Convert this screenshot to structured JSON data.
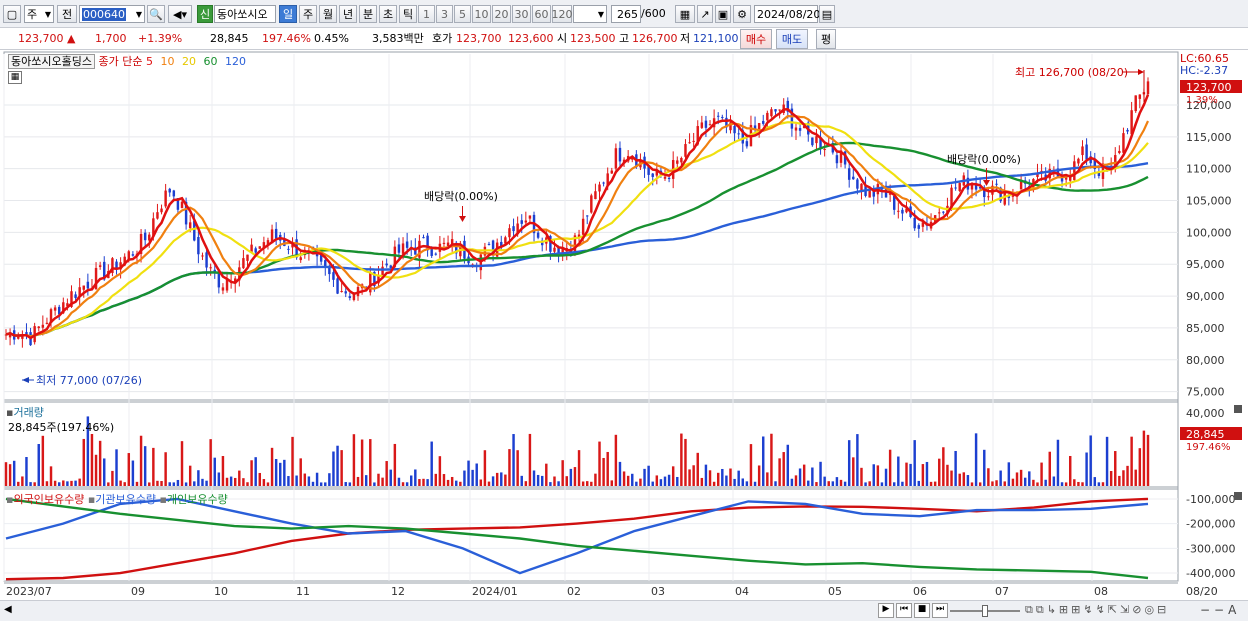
{
  "toolbar": {
    "period_label": "주",
    "prefix_label": "전",
    "stock_code": "000640",
    "credit_badge": "신",
    "stock_name": "동아쏘시오",
    "periods": [
      "일",
      "주",
      "월",
      "년",
      "분",
      "초",
      "틱"
    ],
    "selected_period": "일",
    "minutes": [
      "1",
      "3",
      "5",
      "10",
      "20",
      "30",
      "60",
      "120"
    ],
    "count_display": "265",
    "count_total": "/600",
    "date": "2024/08/20"
  },
  "quote": {
    "price": "123,700",
    "change_arrow": "▲",
    "change": "1,700",
    "change_pct": "+1.39%",
    "volume": "28,845",
    "volume_ratio": "197.46%",
    "turnover": "0.45%",
    "amount": "3,583백만",
    "bid_label": "호가",
    "ask": "123,700",
    "bid": "123,600",
    "open_label": "시",
    "open": "123,500",
    "high_label": "고",
    "high": "126,700",
    "low_label": "저",
    "low": "121,100",
    "buy_label": "매수",
    "sell_label": "매도",
    "eval_label": "평"
  },
  "price_panel": {
    "title": "동아쏘시오홀딩스",
    "ma_label": "종가 단순",
    "ma_periods": [
      "5",
      "10",
      "20",
      "60",
      "120"
    ],
    "ma_colors": [
      "#e01010",
      "#f08010",
      "#f0e010",
      "#189030",
      "#2a5fd8"
    ],
    "lc": "LC:60.65",
    "hc": "HC:-2.37",
    "current_price": "123,700",
    "current_pct": "1.39%",
    "high_annotation": "최고 126,700 (08/20)",
    "low_annotation": "최저 77,000 (07/26)",
    "dividend_labels": [
      "배당락(0.00%)",
      "배당락(0.00%)"
    ],
    "y_ticks": [
      "120,000",
      "115,000",
      "110,000",
      "105,000",
      "100,000",
      "95,000",
      "90,000",
      "85,000",
      "80,000",
      "75,000"
    ]
  },
  "volume_panel": {
    "title": "거래량",
    "value_label": "28,845주(197.46%)",
    "y_tick": "40,000",
    "current": "28,845",
    "current_pct": "197.46%"
  },
  "holding_panel": {
    "series": [
      "외국인보유수량",
      "기관보유수량",
      "개인보유수량"
    ],
    "series_colors": [
      "#d01010",
      "#2a5fd8",
      "#189030"
    ],
    "y_ticks": [
      "-100,000",
      "-200,000",
      "-300,000",
      "-400,000"
    ]
  },
  "x_axis": {
    "labels": [
      "2023/07",
      "09",
      "10",
      "11",
      "12",
      "2024/01",
      "02",
      "03",
      "04",
      "05",
      "06",
      "07",
      "08"
    ],
    "right_label": "08/20"
  },
  "chart_data": {
    "type": "candlestick",
    "ma_close": [
      84000,
      84500,
      83500,
      86000,
      88000,
      90000,
      91500,
      93000,
      94000,
      95500,
      97000,
      99000,
      104000,
      107000,
      103000,
      98000,
      94000,
      92000,
      94000,
      96000,
      98000,
      99500,
      98500,
      97000,
      96000,
      94000,
      92000,
      90500,
      91000,
      93000,
      95000,
      97000,
      97500,
      98000,
      97500,
      98000,
      97000,
      96000,
      97000,
      99000,
      101500,
      102500,
      100000,
      98000,
      97500,
      99000,
      104000,
      108000,
      112000,
      113000,
      111000,
      108500,
      109000,
      111000,
      114000,
      116500,
      117500,
      116000,
      114000,
      116000,
      118000,
      119500,
      117500,
      115000,
      114500,
      113500,
      111000,
      108000,
      106000,
      106500,
      104500,
      102500,
      101500,
      102000,
      105000,
      107500,
      108000,
      107000,
      106500,
      106000,
      107500,
      108000,
      108500,
      109000,
      110000,
      112500,
      110000,
      109000,
      115000,
      120000,
      123700
    ],
    "ylim": [
      74000,
      128000
    ]
  }
}
